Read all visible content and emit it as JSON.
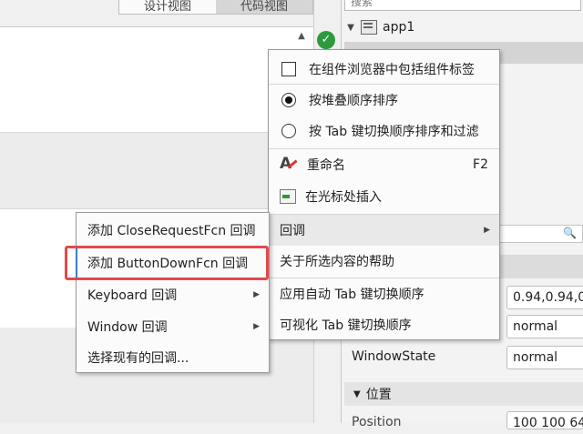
{
  "editor": {
    "view_design": "设计视图",
    "view_code": "代码视图"
  },
  "inspector": {
    "search_placeholder": "搜索",
    "tree_root": "app1",
    "field1_value": "0.94,0.94,0",
    "field2_value": "normal",
    "field3_value": "normal",
    "label3": "WindowState",
    "group2": "位置",
    "next_prop": "Position",
    "next_field_value": "100 100 64"
  },
  "context_menu": {
    "include_tags": "在组件浏览器中包括组件标签",
    "sort_stack": "按堆叠顺序排序",
    "sort_tab": "按 Tab 键切换顺序排序和过滤",
    "rename": "重命名",
    "rename_shortcut": "F2",
    "insert_at_cursor": "在光标处插入",
    "callbacks": "回调",
    "help": "关于所选内容的帮助",
    "apply_tab": "应用自动 Tab 键切换顺序",
    "visualize_tab": "可视化 Tab 键切换顺序"
  },
  "callback_submenu": {
    "close_request": "添加 CloseRequestFcn 回调",
    "button_down": "添加 ButtonDownFcn 回调",
    "keyboard": "Keyboard 回调",
    "window": "Window 回调",
    "select_existing": "选择现有的回调..."
  },
  "colors": {
    "highlight_border": "#e5484d",
    "status_ok": "#2e9a3f"
  }
}
